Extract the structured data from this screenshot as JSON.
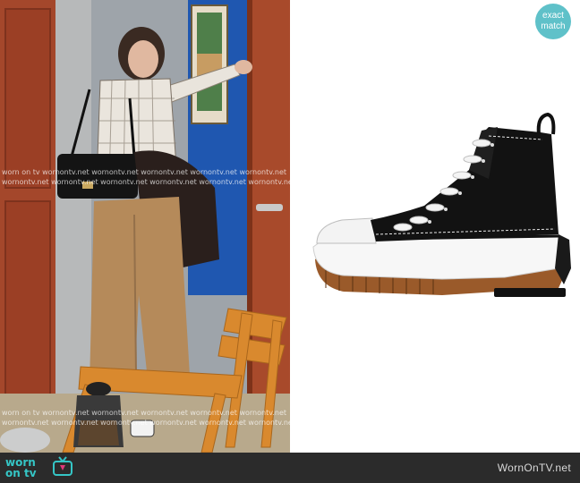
{
  "badge": {
    "line1": "exact",
    "line2": "match"
  },
  "watermark": {
    "row_a": "worn on tv wornontv.net   wornontv.net   wornontv.net   wornontv.net   wornontv.net",
    "row_b": "wornontv.net   wornontv.net   wornontv.net   wornontv.net   wornontv.net   wornontv.net"
  },
  "footer": {
    "logo_line1": "worn",
    "logo_line2": "on tv",
    "site": "WornOnTV.net"
  },
  "colors": {
    "brand": "#35c6c6",
    "badge": "#5fc1c9",
    "footer_bg": "#2b2b2b"
  },
  "icons": {
    "logo": "tv-icon"
  }
}
